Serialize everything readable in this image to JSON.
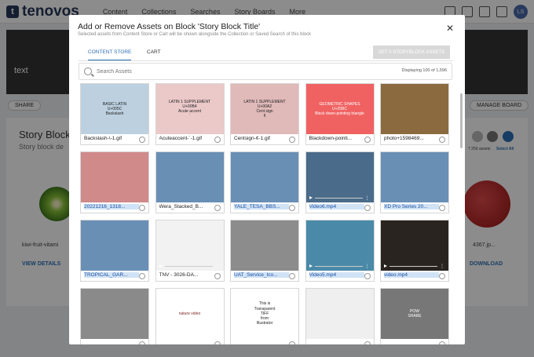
{
  "app": {
    "logo_text": "tenovos",
    "nav": [
      "Content",
      "Collections",
      "Searches",
      "Story Boards",
      "More"
    ],
    "user_initials": "LS"
  },
  "background": {
    "hero_text": "text",
    "share_label": "SHARE",
    "manage_label": "MANAGE BOARD",
    "storyblock_title": "Story Block",
    "storyblock_desc": "Story block de",
    "kiwi_label": "kiwi-fruit-vitami",
    "view_details": "VIEW DETAILS",
    "right_label": "4367.jp...",
    "download": "DOWNLOAD",
    "assets_count": "7 256 assets",
    "select_all": "Select All"
  },
  "modal": {
    "title": "Add or Remove Assets on Block 'Story Block Title'",
    "subtitle": "Selected assets from Content Store or Cart will be shown alongside the Collection or Saved Search of this block",
    "tabs": [
      "CONTENT STORE",
      "CART"
    ],
    "set_button": "SET 0 STORYBLOCK ASSETS",
    "search_placeholder": "Search Assets",
    "display_count": "Displaying 100 of 1,596",
    "assets": [
      {
        "name": "Backslash-\\-1.gif",
        "thumb_lines": [
          "BASIC LATIN",
          "U+005C",
          "Backslash"
        ],
        "bg": "#bcd0e0",
        "fg": "#222"
      },
      {
        "name": "Acuteaccent-´-1.gif",
        "thumb_lines": [
          "LATIN 1 SUPPLEMENT",
          "U+00B4",
          "Acute accent",
          "´"
        ],
        "bg": "#ebc9c9",
        "fg": "#222"
      },
      {
        "name": "Centsign-¢-1.gif",
        "thumb_lines": [
          "LATIN 1 SUPPLEMENT",
          "U+00A2",
          "Cent sign",
          "¢"
        ],
        "bg": "#e0b9b9",
        "fg": "#222"
      },
      {
        "name": "Blackdown-pointi...",
        "thumb_lines": [
          "GEOMETRIC SHAPES",
          "U+25BC",
          "Black down-pointing triangle"
        ],
        "bg": "#f06262",
        "fg": "#fff"
      },
      {
        "name": "photo+1598469...",
        "thumb_lines": [],
        "bg": "#8a6a3e",
        "fg": "#fff"
      },
      {
        "name": "20221216_1318...",
        "thumb_lines": [],
        "bg": "#d08a8a",
        "fg": "#fff",
        "selected": true
      },
      {
        "name": "Wera_Stacked_B...",
        "thumb_lines": [],
        "bg": "#6a8fb5",
        "fg": "#fff"
      },
      {
        "name": "YALE_TESA_BBS...",
        "thumb_lines": [],
        "bg": "#6a8fb5",
        "fg": "#fff",
        "selected": true
      },
      {
        "name": "Video6.mp4",
        "thumb_lines": [],
        "bg": "#4a6b8a",
        "fg": "#fff",
        "video": true,
        "selected": true
      },
      {
        "name": "XD Pro Series 20...",
        "thumb_lines": [],
        "bg": "#6a8fb5",
        "fg": "#fff",
        "selected": true
      },
      {
        "name": "TROPICAL_GAR...",
        "thumb_lines": [],
        "bg": "#6a8fb5",
        "fg": "#fff",
        "selected": true
      },
      {
        "name": "TNV - 3026-DA...",
        "thumb_lines": [],
        "bg": "#f2f2f2",
        "fg": "#333",
        "video": true
      },
      {
        "name": "UAT_Service_Ico...",
        "thumb_lines": [],
        "bg": "#8c8c8c",
        "fg": "#fff",
        "selected": true
      },
      {
        "name": "Video5.mp4",
        "thumb_lines": [],
        "bg": "#4a8aa8",
        "fg": "#fff",
        "video": true,
        "selected": true
      },
      {
        "name": "video.mp4",
        "thumb_lines": [],
        "bg": "#2a2420",
        "fg": "#fff",
        "video": true,
        "selected": true
      },
      {
        "name": "",
        "thumb_lines": [],
        "bg": "#8a8a8a",
        "fg": "#fff"
      },
      {
        "name": "",
        "thumb_lines": [
          "nature video"
        ],
        "bg": "#fff",
        "fg": "#7a1f1f"
      },
      {
        "name": "",
        "thumb_lines": [
          "This is",
          "Transparent",
          "TIFF",
          "from",
          "Illustrator"
        ],
        "bg": "#fff",
        "fg": "#222"
      },
      {
        "name": "",
        "thumb_lines": [],
        "bg": "#efefef",
        "fg": "#222"
      },
      {
        "name": "",
        "thumb_lines": [
          "POW",
          "SHARE"
        ],
        "bg": "#777",
        "fg": "#fff"
      }
    ]
  }
}
